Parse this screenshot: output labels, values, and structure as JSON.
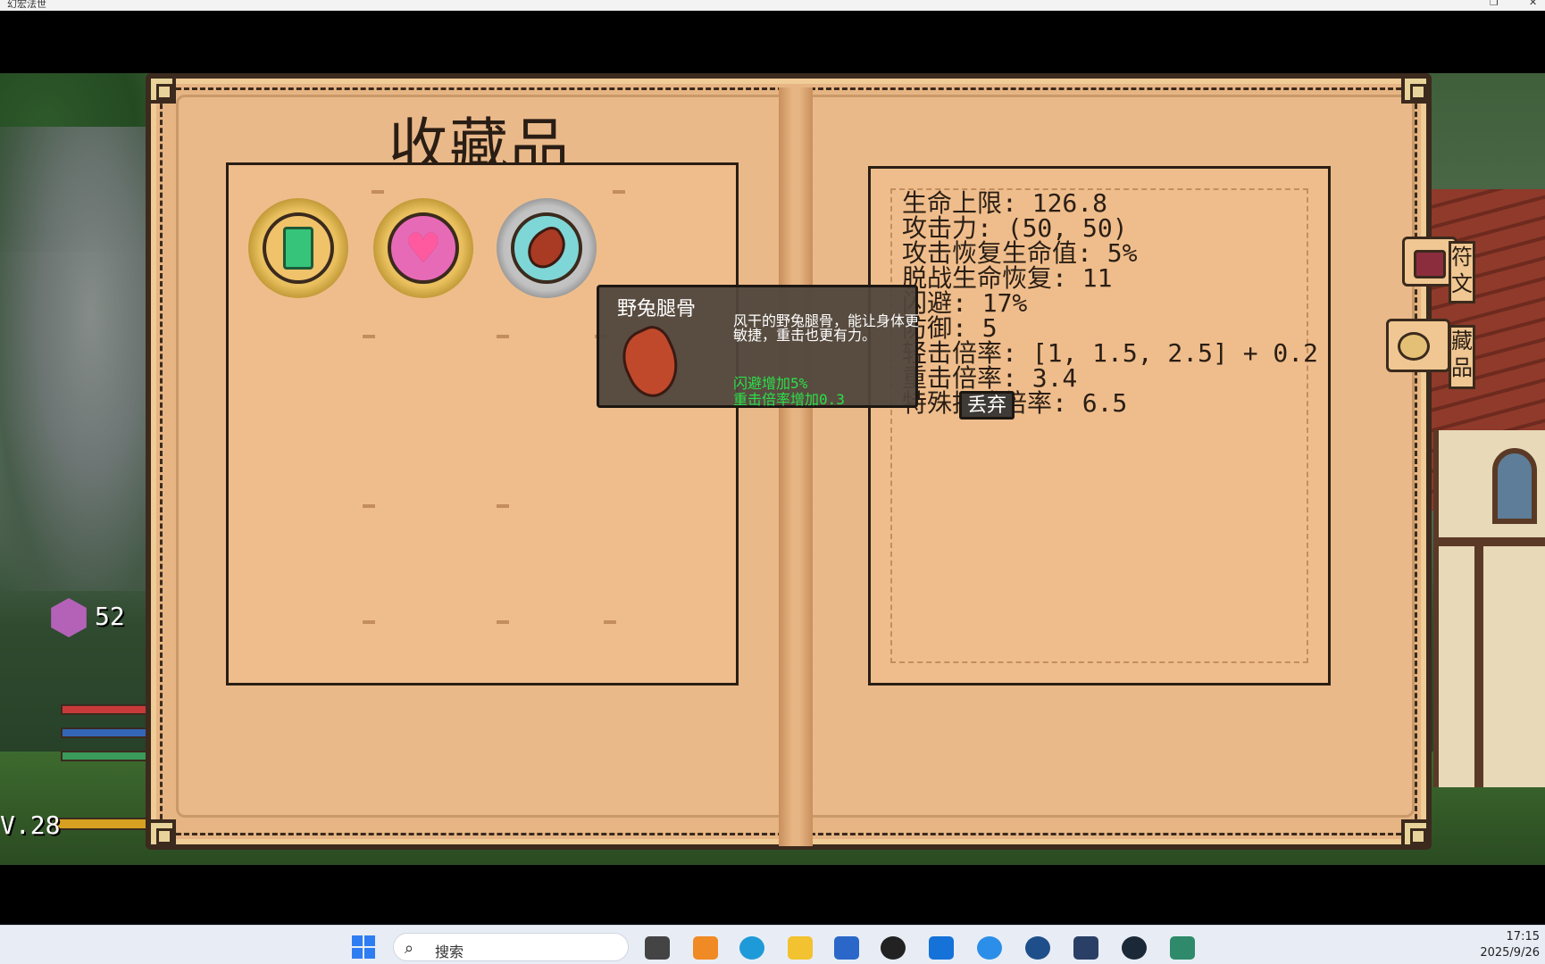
{
  "window": {
    "title": "幻宏法世"
  },
  "hud": {
    "gem_count": "52",
    "level_text": "V.28"
  },
  "book": {
    "title": "收藏品",
    "tabs": [
      {
        "label": "符文",
        "icon": "backpack-icon"
      },
      {
        "label": "藏品",
        "icon": "coins-icon"
      }
    ],
    "stats": [
      "生命上限: 126.8",
      "攻击力: (50, 50)",
      "攻击恢复生命值: 5%",
      "脱战生命恢复: 11",
      "闪避: 17%",
      "防御: 5",
      "轻击倍率: [1, 1.5, 2.5] + 0.2",
      "重击倍率: 3.4",
      "特殊招式倍率: 6.5"
    ],
    "items": [
      {
        "icon": "green-tablet-icon"
      },
      {
        "icon": "heart-icon"
      },
      {
        "icon": "rabbit-leg-icon"
      }
    ]
  },
  "tooltip": {
    "name": "野兔腿骨",
    "description": "风干的野兔腿骨，能让身体更敏捷，重击也更有力。",
    "effects": [
      "闪避增加5%",
      "重击倍率增加0.3"
    ],
    "discard_label": "丢弃"
  },
  "taskbar": {
    "search_placeholder": "搜索",
    "time": "17:15",
    "date": "2025/9/26"
  },
  "colors": {
    "page": "#eab98a",
    "ink": "#2a1e14",
    "effect_green": "#2be04a"
  }
}
